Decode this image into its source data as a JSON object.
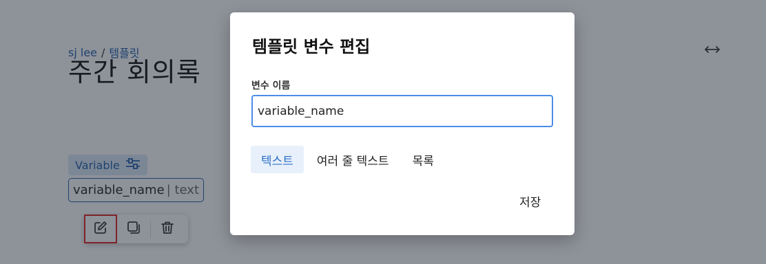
{
  "breadcrumb": {
    "user": "sj lee",
    "separator": "/",
    "section": "템플릿"
  },
  "page": {
    "title": "주간 회의록"
  },
  "editor": {
    "variable_tag_label": "Variable",
    "chip_name": "variable_name",
    "chip_type": "| text"
  },
  "icons": {
    "expand": "horizontal-arrows-icon",
    "variable": "sliders-icon",
    "edit": "pencil-square-icon",
    "duplicate": "copy-icon",
    "delete": "trash-icon"
  },
  "modal": {
    "title": "템플릿 변수 편집",
    "field_label": "변수 이름",
    "field_value": "variable_name",
    "type_tabs": [
      "텍스트",
      "여러 줄 텍스트",
      "목록"
    ],
    "selected_tab": "텍스트",
    "save_label": "저장"
  },
  "colors": {
    "accent": "#2a6fc7",
    "focus_border": "#4a8de8",
    "highlight_border": "#e02020"
  }
}
